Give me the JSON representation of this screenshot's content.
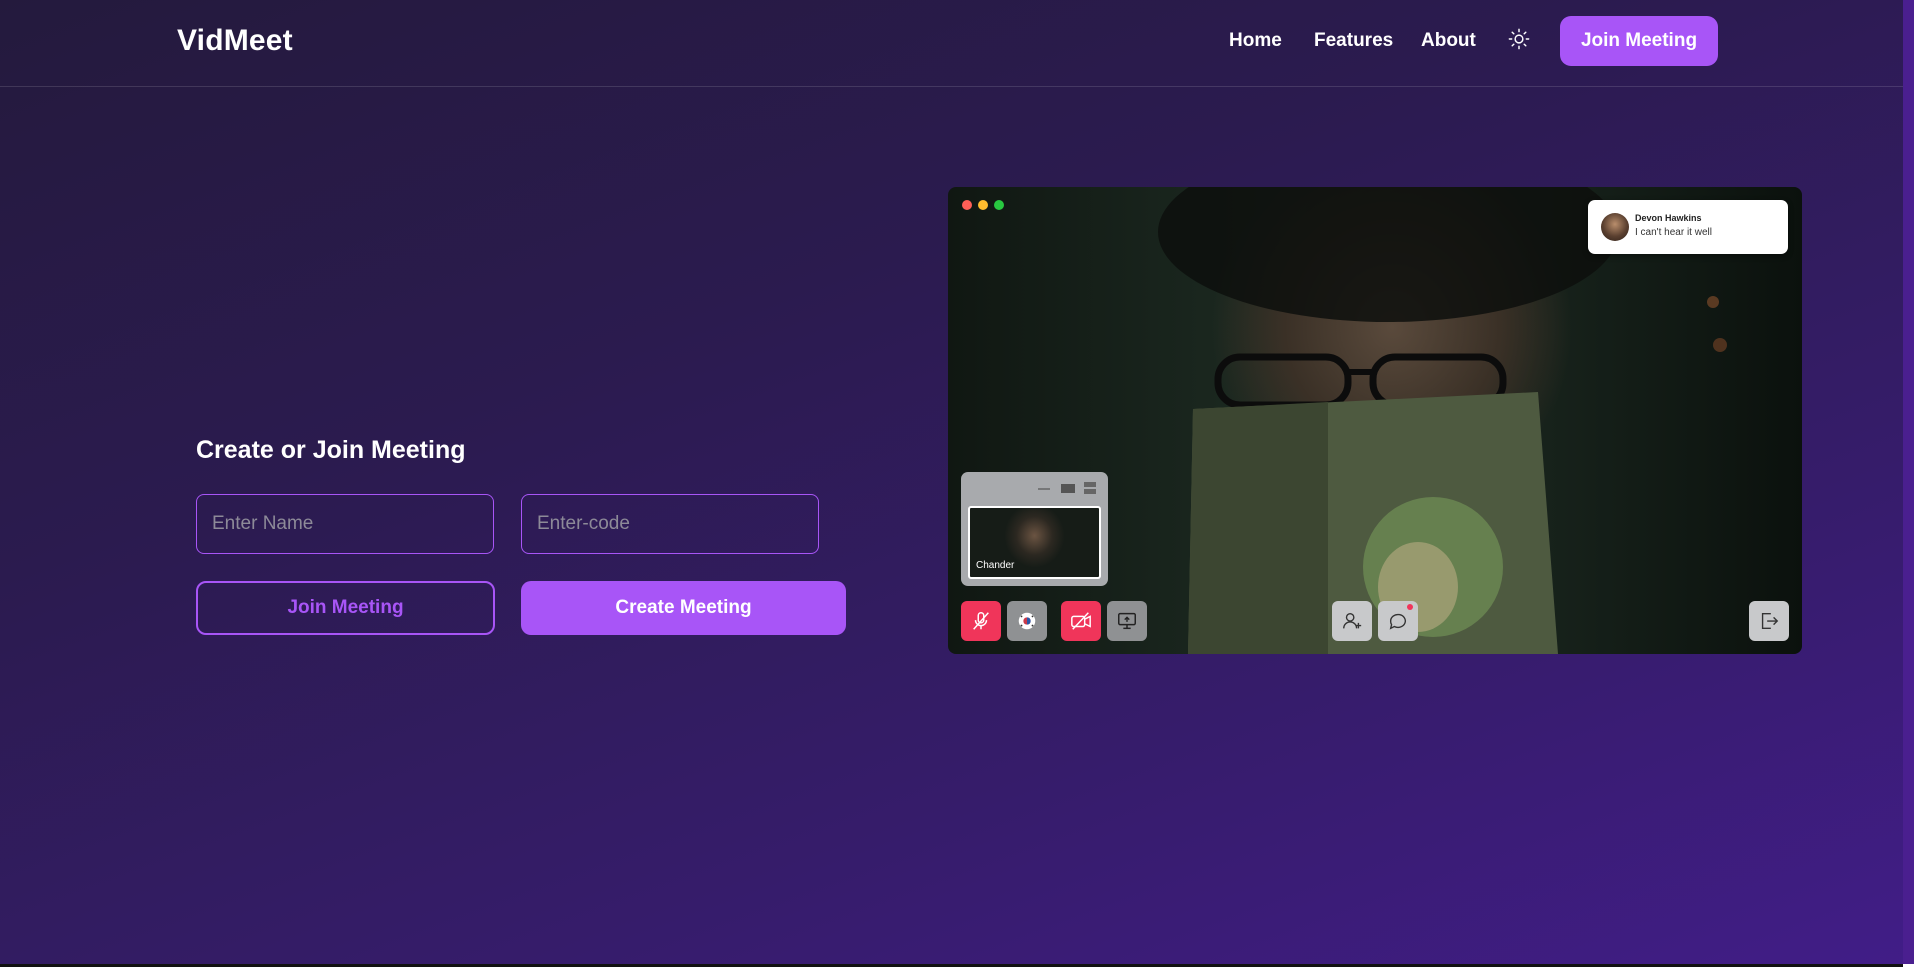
{
  "app": {
    "name": "VidMeet"
  },
  "nav": {
    "links": [
      "Home",
      "Features",
      "About"
    ],
    "theme_icon": "sun-icon",
    "join_button": "Join Meeting"
  },
  "form": {
    "title": "Create or Join Meeting",
    "name_placeholder": "Enter Name",
    "code_placeholder": "Enter-code",
    "join_label": "Join Meeting",
    "create_label": "Create Meeting"
  },
  "preview": {
    "window_dots": [
      "#ff5f57",
      "#febc2e",
      "#28c840"
    ],
    "notification": {
      "name": "Devon Hawkins",
      "message": "I can't hear it well"
    },
    "pip_participant": "Chander",
    "controls": [
      "mic-off-icon",
      "effects-icon",
      "camera-off-icon",
      "screen-share-icon",
      "add-user-icon",
      "chat-icon",
      "leave-icon"
    ]
  },
  "colors": {
    "accent": "#a855f7",
    "danger": "#f0355a"
  }
}
